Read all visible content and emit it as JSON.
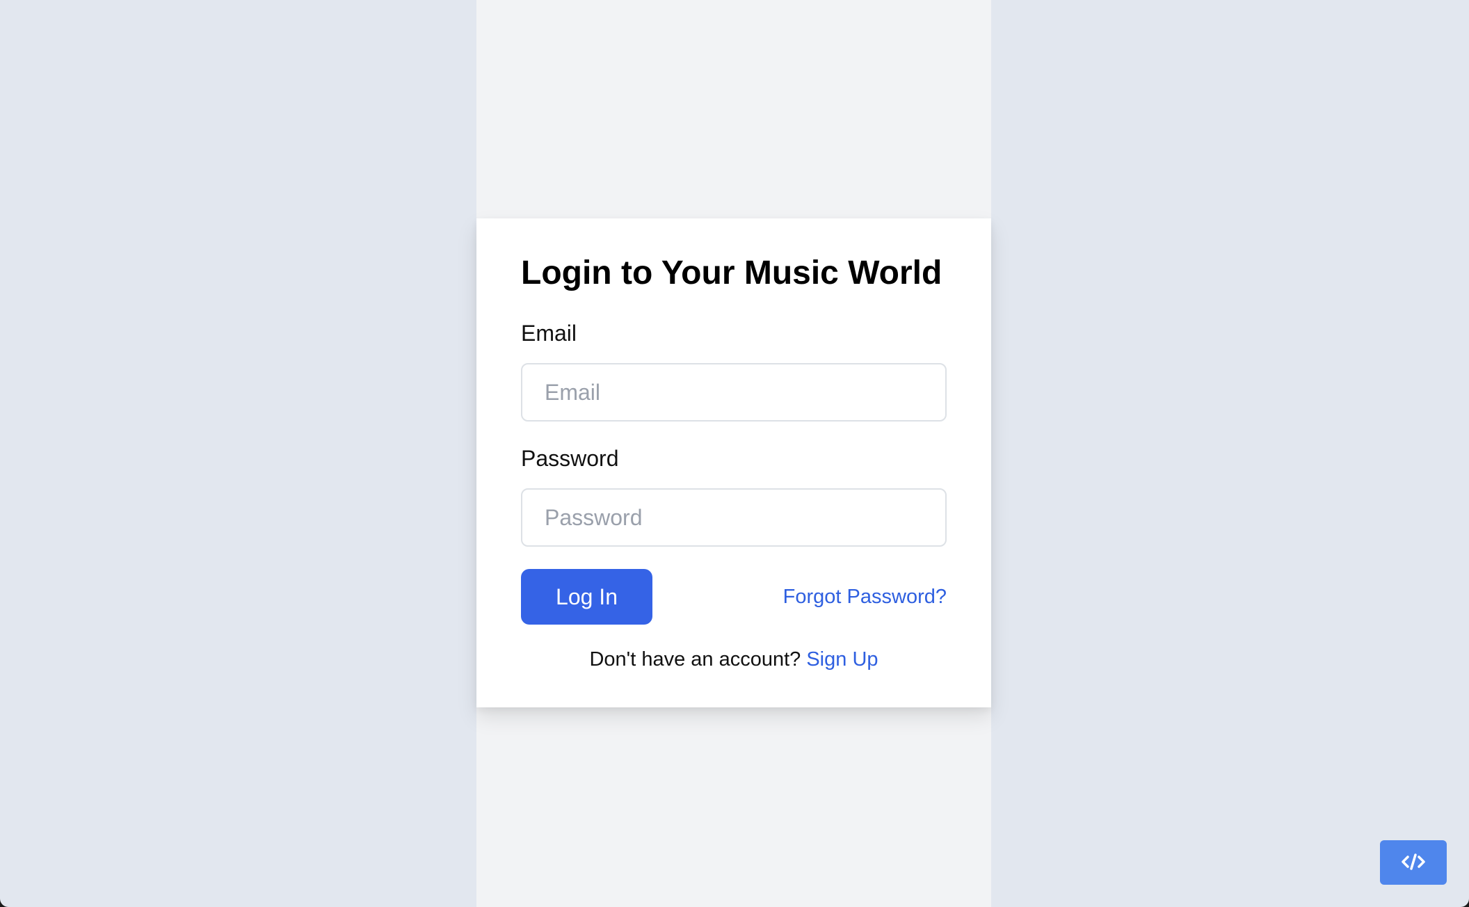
{
  "login": {
    "title": "Login to Your Music World",
    "email_label": "Email",
    "email_placeholder": "Email",
    "email_value": "",
    "password_label": "Password",
    "password_placeholder": "Password",
    "password_value": "",
    "login_button": "Log In",
    "forgot_password": "Forgot Password?",
    "signup_prompt": "Don't have an account?",
    "signup_link": "Sign Up"
  },
  "toolbar": {
    "code_button_icon": "code-icon"
  },
  "colors": {
    "page_background": "#e2e7ef",
    "column_background": "#f2f3f5",
    "card_background": "#ffffff",
    "primary": "#3563e6",
    "link": "#2e5fe0",
    "code_button": "#4f86ec"
  }
}
